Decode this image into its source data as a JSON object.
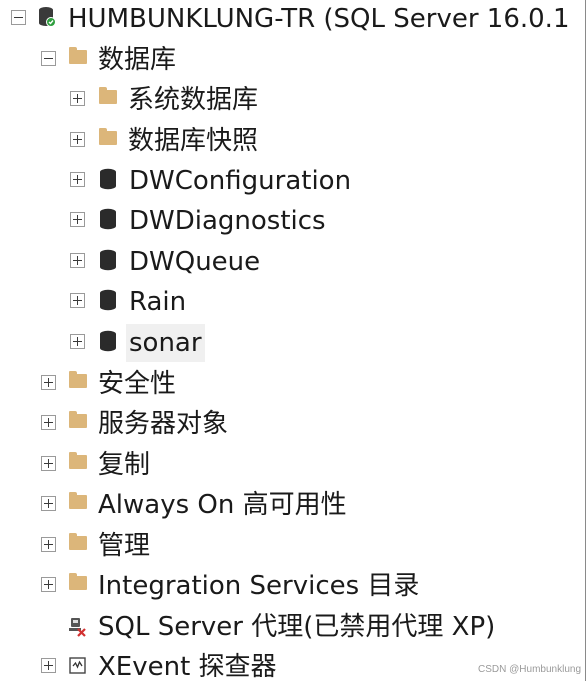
{
  "tree": {
    "server": "HUMBUNKLUNG-TR (SQL Server 16.0.1",
    "databases": {
      "label": "数据库",
      "children": [
        "系统数据库",
        "数据库快照",
        "DWConfiguration",
        "DWDiagnostics",
        "DWQueue",
        "Rain",
        "sonar"
      ]
    },
    "security": "安全性",
    "server_objects": "服务器对象",
    "replication": "复制",
    "always_on": "Always On 高可用性",
    "management": "管理",
    "integration_services": "Integration Services 目录",
    "sql_agent": "SQL Server 代理(已禁用代理 XP)",
    "xevent": "XEvent 探查器"
  },
  "watermark": "CSDN @Humbunklung",
  "colors": {
    "folder": "#dcb67a",
    "database": "#2b2b2b",
    "server_badge": "#2e9e3e",
    "agent_error": "#d23030"
  },
  "icons": {
    "server": "server-icon",
    "folder": "folder-icon",
    "database": "database-icon",
    "agent": "sql-agent-icon",
    "xevent": "xevent-profiler-icon"
  }
}
